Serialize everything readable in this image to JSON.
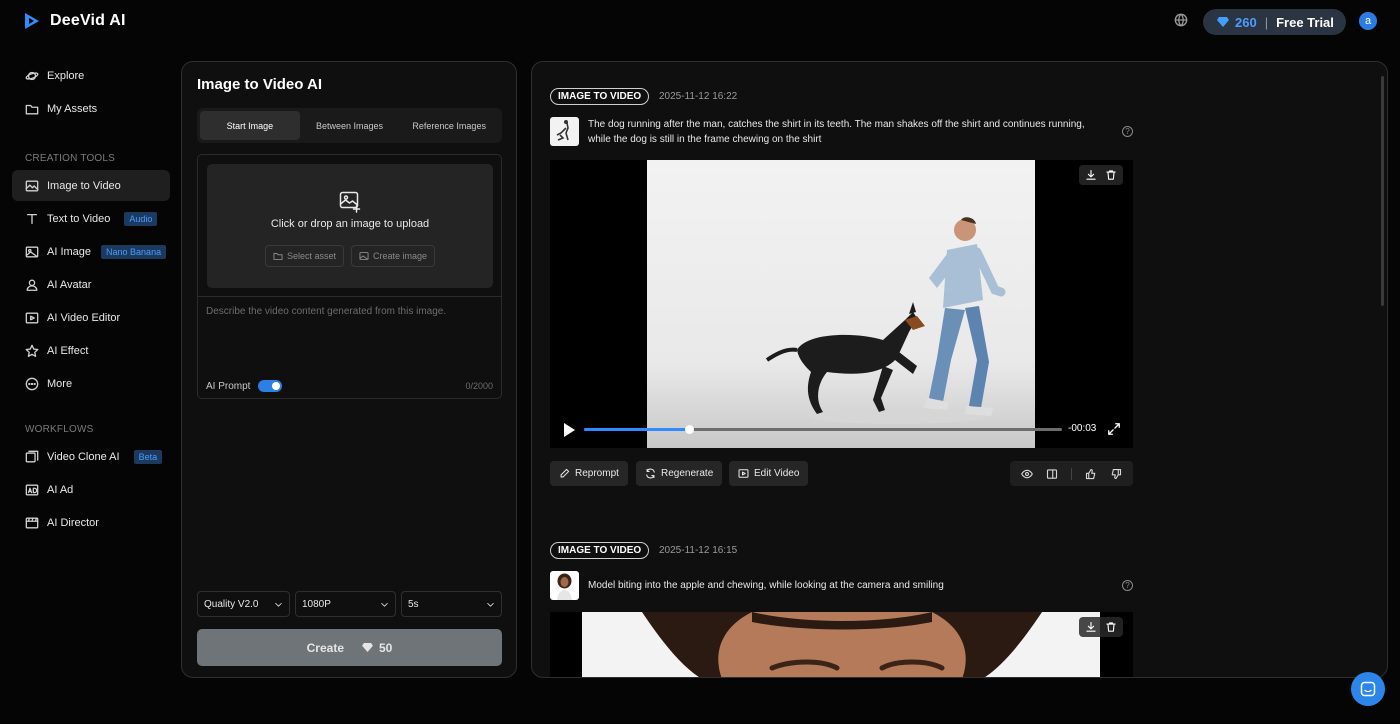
{
  "brand": {
    "name": "DeeVid AI",
    "accent": "#2f8cff"
  },
  "header": {
    "credits": "260",
    "plan": "Free Trial",
    "avatar_letter": "a"
  },
  "sidebar": {
    "top": [
      {
        "label": "Explore",
        "icon": "planet-icon"
      },
      {
        "label": "My Assets",
        "icon": "folder-icon"
      }
    ],
    "creation_title": "CREATION TOOLS",
    "creation": [
      {
        "label": "Image to Video",
        "icon": "image-icon",
        "active": true
      },
      {
        "label": "Text to Video",
        "icon": "text-icon",
        "badge": "Audio"
      },
      {
        "label": "AI Image",
        "icon": "ai-image-icon",
        "badge": "Nano Banana"
      },
      {
        "label": "AI Avatar",
        "icon": "avatar-icon"
      },
      {
        "label": "AI Video Editor",
        "icon": "video-editor-icon"
      },
      {
        "label": "AI Effect",
        "icon": "star-icon"
      },
      {
        "label": "More",
        "icon": "more-icon"
      }
    ],
    "workflows_title": "WORKFLOWS",
    "workflows": [
      {
        "label": "Video Clone AI",
        "icon": "video-clone-icon",
        "badge": "Beta"
      },
      {
        "label": "AI Ad",
        "icon": "ad-icon"
      },
      {
        "label": "AI Director",
        "icon": "director-icon"
      }
    ]
  },
  "left_panel": {
    "title": "Image to Video AI",
    "tabs": [
      "Start Image",
      "Between Images",
      "Reference Images"
    ],
    "active_tab": 0,
    "upload_text": "Click or drop an image to upload",
    "select_asset": "Select asset",
    "create_image": "Create image",
    "prompt_placeholder": "Describe the video content generated from this image.",
    "ai_prompt_label": "AI Prompt",
    "ai_prompt_on": true,
    "char_count": "0/2000",
    "quality": "Quality V2.0",
    "resolution": "1080P",
    "duration": "5s",
    "create_label": "Create",
    "create_cost": "50"
  },
  "results": [
    {
      "type": "IMAGE TO VIDEO",
      "timestamp": "2025-11-12 16:22",
      "prompt": "The dog running after the man, catches the shirt in its teeth. The man shakes off the shirt and continues running, while the dog is still in the frame chewing on the shirt",
      "progress": 0.22,
      "time_remaining": "-00:03",
      "actions": [
        "Reprompt",
        "Regenerate",
        "Edit Video"
      ]
    },
    {
      "type": "IMAGE TO VIDEO",
      "timestamp": "2025-11-12 16:15",
      "prompt": "Model biting into the apple and chewing, while looking at the camera and smiling"
    }
  ]
}
